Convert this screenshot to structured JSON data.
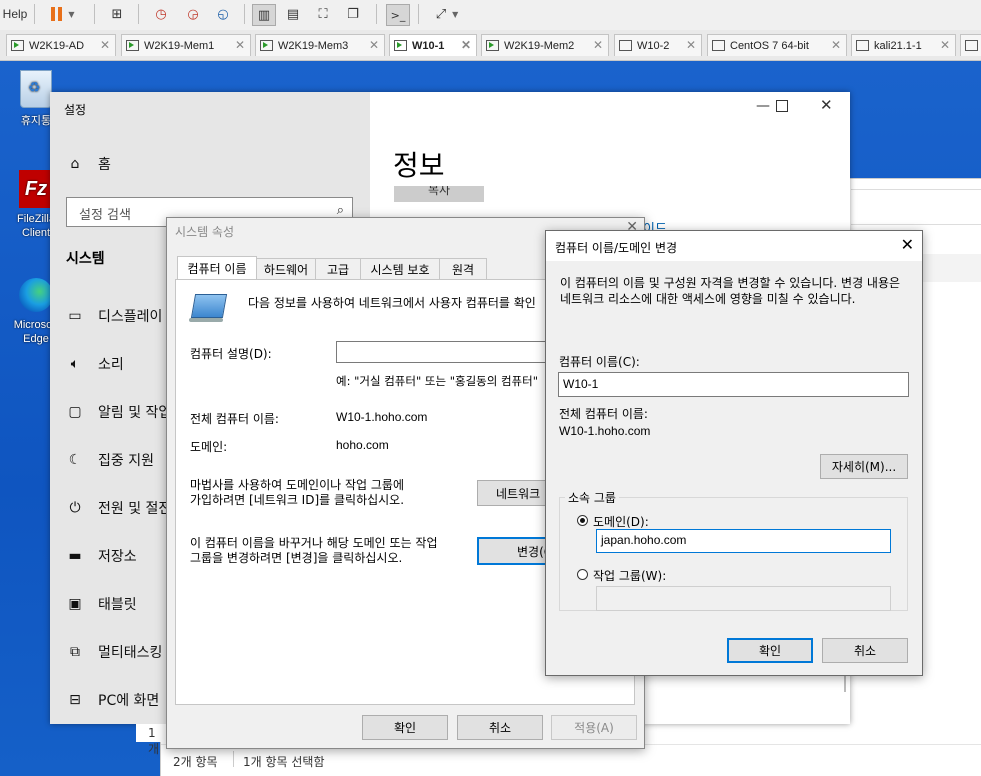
{
  "vmware": {
    "menu_help": "Help",
    "tabs": [
      {
        "label": "W2K19-AD",
        "running": true,
        "active": false
      },
      {
        "label": "W2K19-Mem1",
        "running": true,
        "active": false
      },
      {
        "label": "W2K19-Mem3",
        "running": true,
        "active": false
      },
      {
        "label": "W10-1",
        "running": true,
        "active": true
      },
      {
        "label": "W2K19-Mem2",
        "running": true,
        "active": false
      },
      {
        "label": "W10-2",
        "running": false,
        "active": false
      },
      {
        "label": "CentOS 7 64-bit",
        "running": false,
        "active": false
      },
      {
        "label": "kali21.1-1",
        "running": false,
        "active": false
      }
    ]
  },
  "desktop": {
    "icons": [
      {
        "label": "휴지통"
      },
      {
        "label": "FileZilla Client"
      },
      {
        "label": "Microsoft Edge"
      }
    ]
  },
  "settings": {
    "title": "설정",
    "home": "홈",
    "search_placeholder": "설정 검색",
    "section": "시스템",
    "nav": [
      "디스플레이",
      "소리",
      "알림 및 작업",
      "집중 지원",
      "전원 및 절전",
      "저장소",
      "태블릿",
      "멀티태스킹",
      "PC에 화면"
    ],
    "page_title": "정보",
    "copy_btn": "복사",
    "link_partial": "이드"
  },
  "explorer": {
    "status_count": "2개 항목",
    "status_selected": "1개 항목 선택함",
    "row_partial": "1개"
  },
  "sysprops": {
    "title": "시스템 속성",
    "tabs": [
      "컴퓨터 이름",
      "하드웨어",
      "고급",
      "시스템 보호",
      "원격"
    ],
    "intro": "다음 정보를 사용하여 네트워크에서 사용자 컴퓨터를 확인",
    "desc_label": "컴퓨터 설명(D):",
    "desc_value": "",
    "desc_example": "예: \"거실 컴퓨터\" 또는 \"홍길동의 컴퓨터\"",
    "fullname_label": "전체 컴퓨터 이름:",
    "fullname_value": "W10-1.hoho.com",
    "domain_label": "도메인:",
    "domain_value": "hoho.com",
    "wizard_text": "마법사를 사용하여 도메인이나 작업 그룹에\n가입하려면 [네트워크 ID]를 클릭하십시오.",
    "network_id_btn": "네트워크 ID",
    "rename_text": "이 컴퓨터 이름을 바꾸거나 해당 도메인 또는 작업\n그룹을 변경하려면 [변경]을 클릭하십시오.",
    "change_btn": "변경(C)",
    "ok": "확인",
    "cancel": "취소",
    "apply": "적용(A)"
  },
  "rename": {
    "title": "컴퓨터 이름/도메인 변경",
    "desc": "이 컴퓨터의 이름 및 구성원 자격을 변경할 수 있습니다. 변경 내용은 네트워크 리소스에 대한 액세스에 영향을 미칠 수 있습니다.",
    "name_label": "컴퓨터 이름(C):",
    "name_value": "W10-1",
    "fullname_label": "전체 컴퓨터 이름:",
    "fullname_value": "W10-1.hoho.com",
    "more_btn": "자세히(M)...",
    "member_group": "소속 그룹",
    "domain_radio": "도메인(D):",
    "domain_value": "japan.hoho.com",
    "workgroup_radio": "작업 그룹(W):",
    "workgroup_value": "",
    "ok": "확인",
    "cancel": "취소"
  }
}
